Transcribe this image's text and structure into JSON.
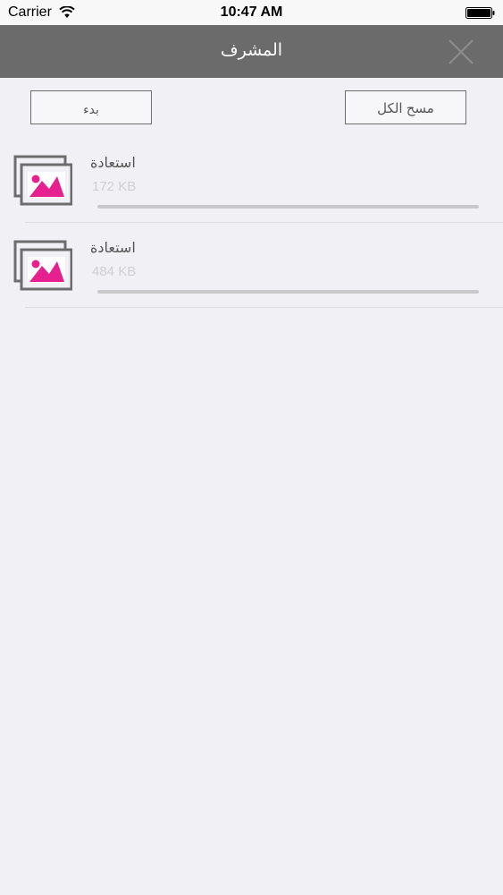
{
  "status_bar": {
    "carrier": "Carrier",
    "time": "10:47 AM"
  },
  "nav": {
    "title": "المشرف",
    "close_icon": "close-icon"
  },
  "actions": {
    "start_label": "بدء",
    "clear_all_label": "مسح الكل"
  },
  "downloads": [
    {
      "title": "استعادة",
      "size": "172 KB",
      "progress": 0,
      "icon": "image-stack-icon"
    },
    {
      "title": "استعادة",
      "size": "484 KB",
      "progress": 0,
      "icon": "image-stack-icon"
    }
  ],
  "colors": {
    "nav_bg": "#6b6b6b",
    "accent": "#e6208f",
    "background": "#f1f0f4"
  }
}
